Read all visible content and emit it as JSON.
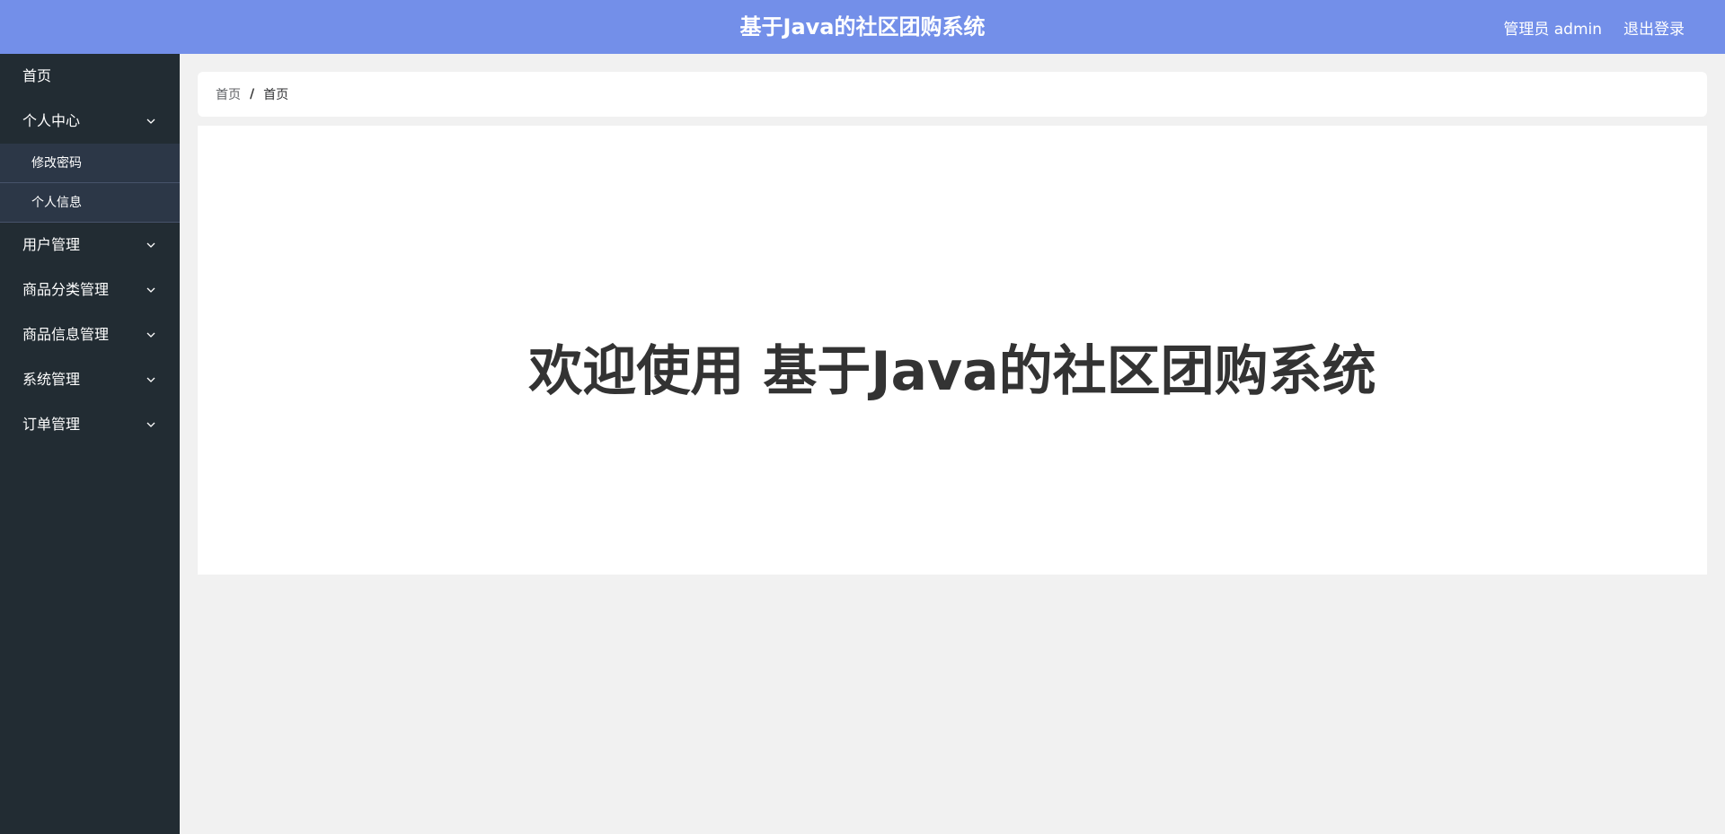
{
  "header": {
    "title": "基于Java的社区团购系统",
    "user_label": "管理员 admin",
    "logout_label": "退出登录"
  },
  "sidebar": {
    "items": [
      {
        "label": "首页"
      },
      {
        "label": "个人中心",
        "expanded": true,
        "children": [
          {
            "label": "修改密码"
          },
          {
            "label": "个人信息"
          }
        ]
      },
      {
        "label": "用户管理"
      },
      {
        "label": "商品分类管理"
      },
      {
        "label": "商品信息管理"
      },
      {
        "label": "系统管理"
      },
      {
        "label": "订单管理"
      }
    ]
  },
  "breadcrumb": {
    "home": "首页",
    "separator": "/",
    "current": "首页"
  },
  "main": {
    "welcome": "欢迎使用 基于Java的社区团购系统"
  },
  "colors": {
    "header_bg": "#738fe9",
    "sidebar_bg": "#222c33",
    "submenu_bg": "#2c3747"
  },
  "icons": {
    "expand": "chevron-down-icon"
  }
}
